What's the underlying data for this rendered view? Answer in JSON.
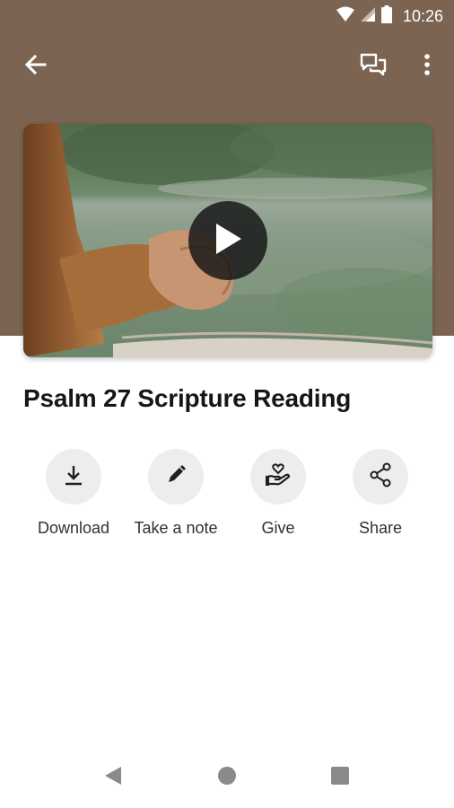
{
  "status_bar": {
    "time": "10:26",
    "icons": [
      "wifi-icon",
      "signal-icon",
      "battery-icon"
    ]
  },
  "app_bar": {
    "back_icon": "arrow-left-icon",
    "actions": [
      "chat-bubbles-icon",
      "more-vertical-icon"
    ]
  },
  "video": {
    "play_icon": "play-icon"
  },
  "content": {
    "title": "Psalm 27 Scripture Reading"
  },
  "actions": [
    {
      "label": "Download",
      "icon": "download-icon"
    },
    {
      "label": "Take a note",
      "icon": "pencil-icon"
    },
    {
      "label": "Give",
      "icon": "heart-hand-icon"
    },
    {
      "label": "Share",
      "icon": "share-icon"
    }
  ],
  "nav_bar": {
    "icons": [
      "back-triangle-icon",
      "home-circle-icon",
      "recents-square-icon"
    ]
  },
  "colors": {
    "header_background": "#7b6452",
    "action_circle": "#ededed",
    "title_text": "#161616"
  }
}
